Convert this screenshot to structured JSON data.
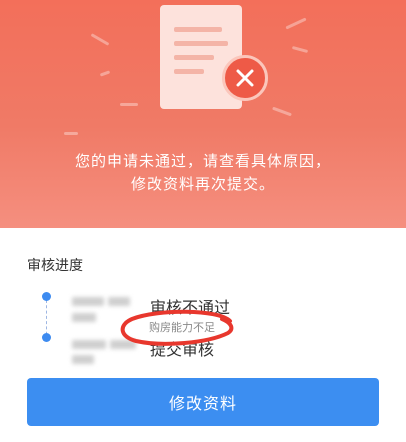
{
  "hero": {
    "icon": "document-rejected-icon",
    "message_line1": "您的申请未通过，请查看具体原因，",
    "message_line2": "修改资料再次提交。"
  },
  "progress": {
    "title": "审核进度",
    "steps": [
      {
        "status": "审核不通过",
        "reason": "购房能力不足",
        "status_color": "#3d8bf0"
      },
      {
        "status": "提交审核",
        "status_color": "#3d8bf0"
      }
    ]
  },
  "action": {
    "edit_label": "修改资料"
  },
  "colors": {
    "hero_bg": "#f36f5a",
    "accent_blue": "#3c8ef1",
    "annotation_red": "#e8372d"
  }
}
